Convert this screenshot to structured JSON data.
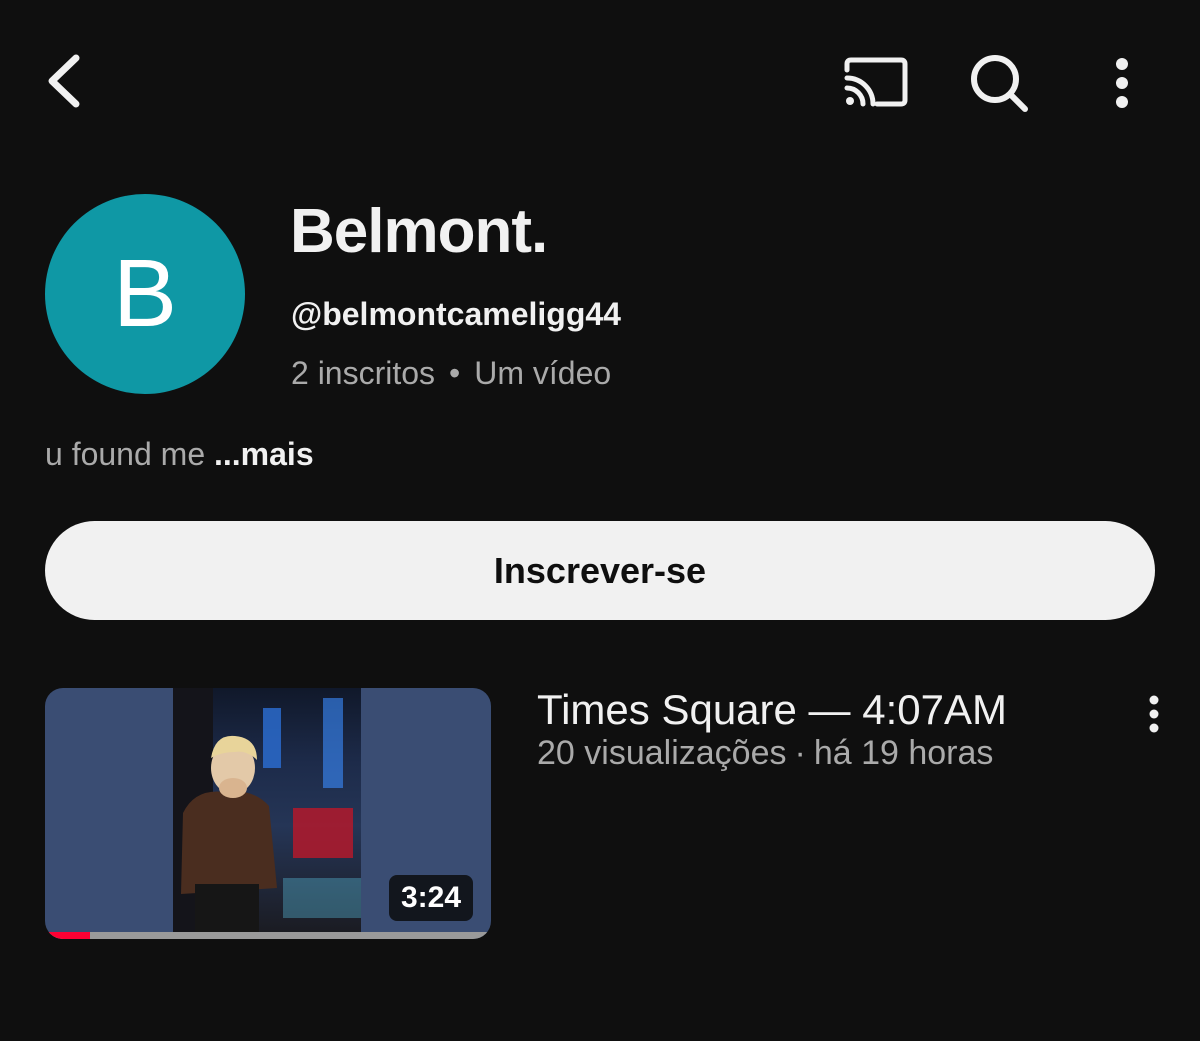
{
  "header": {
    "back_icon": "chevron-left-icon",
    "cast_icon": "cast-icon",
    "search_icon": "search-icon",
    "menu_icon": "more-vertical-icon"
  },
  "channel": {
    "avatar_letter": "B",
    "avatar_color": "#0f98a5",
    "name": "Belmont.",
    "handle": "@belmontcameligg44",
    "subscribers": "2 inscritos",
    "separator": "•",
    "videos": "Um vídeo",
    "description": "u found me",
    "more_label": "...mais"
  },
  "subscribe": {
    "label": "Inscrever-se"
  },
  "videos": [
    {
      "title": "Times Square — 4:07AM",
      "views": "20 visualizações",
      "separator": "·",
      "age": "há 19 horas",
      "duration": "3:24",
      "watched_fraction": 0.1,
      "menu_icon": "more-vertical-icon"
    }
  ],
  "colors": {
    "background": "#0f0f0f",
    "primary_text": "#f1f1f1",
    "secondary_text": "#aaaaaa",
    "progress": "#ff0033"
  }
}
